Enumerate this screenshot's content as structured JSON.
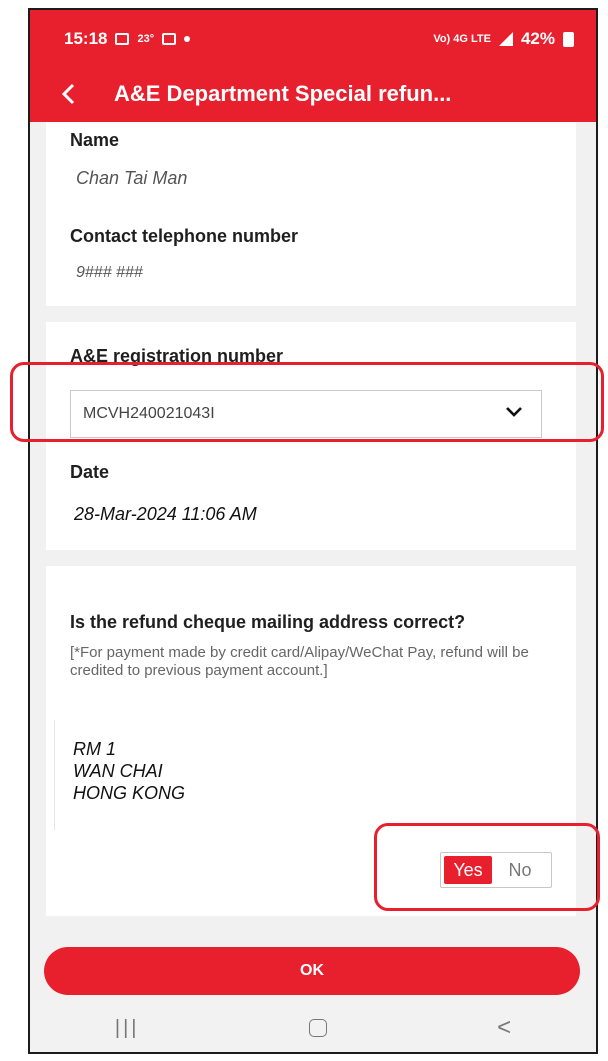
{
  "status_bar": {
    "time": "15:18",
    "temperature": "23°",
    "network_label": "Vo) 4G LTE",
    "battery": "42%"
  },
  "header": {
    "title": "A&E Department Special refun..."
  },
  "personal": {
    "name_label": "Name",
    "name_value": "Chan Tai Man",
    "phone_label": "Contact telephone number",
    "phone_value": "9### ###"
  },
  "registration": {
    "label": "A&E registration number",
    "selected_value": "MCVH240021043I",
    "date_label": "Date",
    "date_value": "28-Mar-2024 11:06 AM"
  },
  "address_section": {
    "question": "Is the refund cheque mailing address correct?",
    "note": "[*For payment made by credit card/Alipay/WeChat Pay, refund will be credited to previous payment account.]",
    "address_lines": [
      "RM 1",
      "WAN CHAI",
      "HONG KONG"
    ],
    "toggle_yes": "Yes",
    "toggle_no": "No",
    "selected": "Yes"
  },
  "footer": {
    "ok_label": "OK"
  },
  "nav_bar": {
    "recents": "|||",
    "back": "<"
  },
  "colors": {
    "brand_red": "#e8202e",
    "background": "#f1f1f1",
    "card": "#ffffff"
  },
  "icons": [
    "back-arrow-icon",
    "gallery-icon",
    "alarm-icon",
    "signal-icon",
    "battery-icon",
    "chevron-down-icon",
    "home-icon"
  ]
}
